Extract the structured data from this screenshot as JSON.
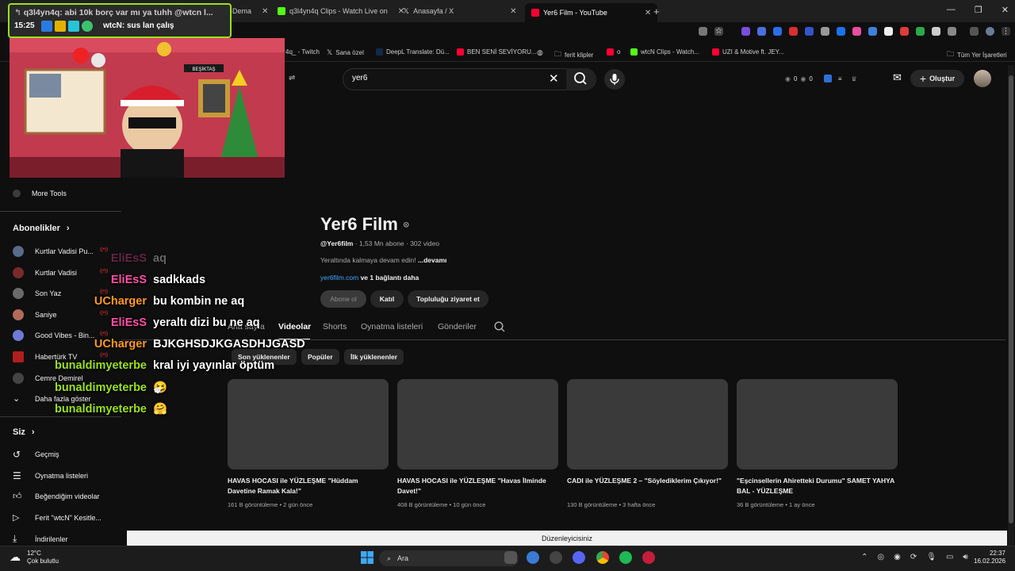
{
  "browser": {
    "tabs": [
      {
        "label": "-Dema",
        "active": false
      },
      {
        "label": "q3l4yn4q Clips - Watch Live on",
        "active": false
      },
      {
        "label": "Anasayfa / X",
        "active": false
      },
      {
        "label": "Yer6 Film - YouTube",
        "active": true
      }
    ],
    "new_tab": "+",
    "bookmarks": [
      "4q_ - Twitch",
      "Sana özel",
      "DeepL Translate: Dü...",
      "BEN SENİ SEVİYORU...",
      "ferit klipler",
      "o",
      "wtcN Clips - Watch...",
      "UZI & Motive ft. JEY...",
      "Tüm Yer İşaretleri"
    ]
  },
  "youtube": {
    "search_value": "yer6",
    "create_label": "Oluştur",
    "header_counts": [
      "0",
      "0"
    ]
  },
  "sidebar": {
    "more_tools": "More Tools",
    "subscriptions_heading": "Abonelikler",
    "subscriptions": [
      "Kurtlar Vadisi Pu...",
      "Kurtlar Vadisi",
      "Son Yaz",
      "Saniye",
      "Good Vibes - Bin...",
      "Habertürk TV",
      "Cemre Demirel"
    ],
    "show_more": "Daha fazla göster",
    "you_heading": "Siz",
    "you_items": [
      "Geçmiş",
      "Oynatma listeleri",
      "Beğendiğim videolar",
      "Ferit \"wtcN\" Kesitle...",
      "İndirilenler"
    ]
  },
  "channel": {
    "name": "Yer6 Film",
    "handle": "@Yer6film",
    "stats": "· 1,53 Mn abone · 302 video",
    "description": "Yeraltında kalmaya devam edin!",
    "description_more": "...devamı",
    "link": "yer6film.com",
    "link_more": "ve 1 bağlantı daha",
    "buttons": [
      "Abone ol",
      "Katıl",
      "Topluluğu ziyaret et"
    ],
    "tabs": [
      "Ana sayfa",
      "Videolar",
      "Shorts",
      "Oynatma listeleri",
      "Gönderiler"
    ],
    "active_tab": "Videolar",
    "filters": [
      "Son yüklenenler",
      "Popüler",
      "İlk yüklenenler"
    ]
  },
  "videos": [
    {
      "title": "HAVAS HOCASI ile YÜZLEŞME \"Hüddam Davetine Ramak Kala!\"",
      "meta": "161 B görüntüleme • 2 gün önce"
    },
    {
      "title": "HAVAS HOCASI ile YÜZLEŞME \"Havas İlminde Davet!\"",
      "meta": "408 B görüntüleme • 10 gün önce"
    },
    {
      "title": "CADI ile YÜZLEŞME 2 – \"Söylediklerim Çıkıyor!\"",
      "meta": "130 B görüntüleme • 3 hafta önce"
    },
    {
      "title": "\"Eşcinsellerin Ahiretteki Durumu\" SAMET YAHYA BAL - YÜZLEŞME",
      "meta": "36 B görüntüleme • 1 ay önce"
    }
  ],
  "status_bar": "Düzenleyicisiniz",
  "stream_overlay": {
    "title_line": "q3l4yn4q: abi 10k borç var mı ya tuhh @wtcn l...",
    "time": "15:25",
    "message": "wtcN: sus lan çalış",
    "chat": [
      {
        "user": "EliEsS",
        "msg": "aq",
        "color": "#ff4fa6",
        "faded": true
      },
      {
        "user": "EliEsS",
        "msg": "sadkkads",
        "color": "#ff4fa6",
        "faded": false
      },
      {
        "user": "UCharger",
        "msg": "bu kombin ne aq",
        "color": "#ff9a1f",
        "faded": false
      },
      {
        "user": "EliEsS",
        "msg": "yeraltı dizi bu ne aq",
        "color": "#ff4fa6",
        "faded": false
      },
      {
        "user": "UCharger",
        "msg": "BJKGHSDJKGASDHJGASD",
        "color": "#ff9a1f",
        "faded": false
      },
      {
        "user": "bunaldimyeterbe",
        "msg": "kral iyi yayınlar öptüm",
        "color": "#9be21a",
        "faded": false
      },
      {
        "user": "bunaldimyeterbe",
        "msg": "🤧",
        "color": "#9be21a",
        "faded": false
      },
      {
        "user": "bunaldimyeterbe",
        "msg": "🤗",
        "color": "#9be21a",
        "faded": false
      }
    ]
  },
  "taskbar": {
    "weather_temp": "12°C",
    "weather_desc": "Çok bulutlu",
    "search_label": "Ara",
    "time": "22:37",
    "date": "16.02.2026"
  },
  "colors": {
    "accent_blue": "#3ea6ff",
    "bg": "#0f0f0f",
    "chip": "#272727",
    "overlay_border": "#9be21a"
  }
}
